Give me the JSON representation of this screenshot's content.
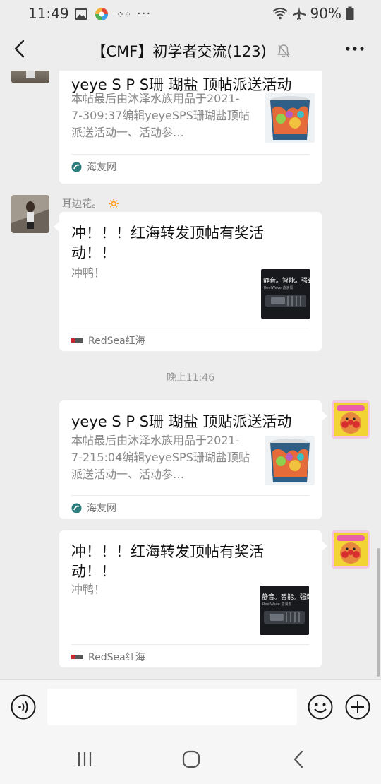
{
  "status_bar": {
    "time": "11:49",
    "battery": "90%"
  },
  "header": {
    "title": "【CMF】初学者交流(123)"
  },
  "messages": [
    {
      "side": "left",
      "title": "yeye S P S珊 瑚盐 顶帖派送活动",
      "desc": "本帖最后由沐泽水族用品于2021-7-309:37编辑yeyeSPS珊瑚盐顶帖派送活动一、活动参…",
      "source": "海友网"
    },
    {
      "side": "left",
      "sender": "耳边花。",
      "sender_emoji": "🔅",
      "title": "冲！！！红海转发顶帖有奖活动！！",
      "desc": "冲鸭！",
      "source": "RedSea红海",
      "thumb_text": "静音。智能。强劲",
      "thumb_sub": "ReefWave 造浪泵"
    },
    {
      "timestamp": "晚上11:46"
    },
    {
      "side": "right",
      "title": "yeye S P S珊 瑚盐 顶贴派送活动",
      "desc": "本帖最后由沐泽水族用品于2021-7-215:04编辑yeyeSPS珊瑚盐顶贴派送活动一、活动参…",
      "source": "海友网"
    },
    {
      "side": "right",
      "title": "冲！！！红海转发顶帖有奖活动！！",
      "desc": "冲鸭！",
      "source": "RedSea红海",
      "thumb_text": "静音。智能。强劲",
      "thumb_sub": "ReefWave 造浪泵"
    }
  ],
  "icons": {
    "voice": "voice-icon",
    "emoji": "emoji-icon",
    "plus": "plus-icon",
    "mute": "mute-bell-icon"
  },
  "colors": {
    "background": "#ededed",
    "card": "#ffffff",
    "secondary_text": "#888888"
  }
}
